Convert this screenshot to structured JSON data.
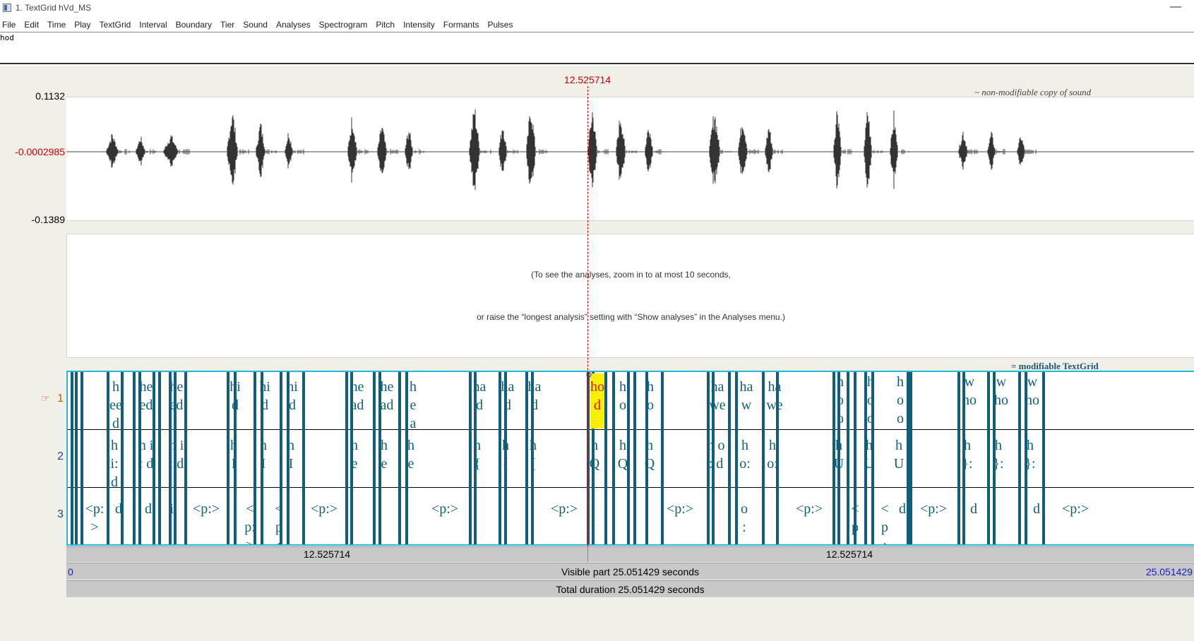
{
  "window": {
    "title": "1. TextGrid hVd_MS"
  },
  "menu": [
    "File",
    "Edit",
    "Time",
    "Play",
    "TextGrid",
    "Interval",
    "Boundary",
    "Tier",
    "Sound",
    "Analyses",
    "Spectrogram",
    "Pitch",
    "Intensity",
    "Formants",
    "Pulses"
  ],
  "text_field": {
    "value": "hod"
  },
  "cursor": {
    "time": "12.525714",
    "time_s": 12.525714
  },
  "sound": {
    "max_label": "0.1132",
    "center_label": "-0.0002985",
    "min_label": "-0.1389",
    "corner_note": "~ non-modifiable copy of sound"
  },
  "analysis": {
    "line1": "(To see the analyses, zoom in to at most 10 seconds,",
    "line2": "or raise the “longest analysis” setting with “Show analyses” in the Analyses menu.)"
  },
  "textgrid": {
    "corner_note": "= modifiable TextGrid",
    "selected_tier_marker": "☞",
    "tier_numbers": [
      "1",
      "2",
      "3"
    ],
    "tier1_labels": [
      {
        "t": 2.05,
        "text": "h\nee\nd"
      },
      {
        "t": 3.1,
        "text": "he\ned"
      },
      {
        "t": 4.05,
        "text": "he\ned"
      },
      {
        "t": 6.45,
        "text": "hi\nd"
      },
      {
        "t": 7.2,
        "text": "hi\nd"
      },
      {
        "t": 8.0,
        "text": "hi\nd"
      },
      {
        "t": 10.45,
        "text": "he\nad"
      },
      {
        "t": 11.2,
        "text": "he\nad"
      },
      {
        "t": 11.9,
        "text": "h\ne\na"
      },
      {
        "t": 14.75,
        "text": "ha\nd"
      },
      {
        "t": 15.45,
        "text": "ha\nd"
      },
      {
        "t": 16.15,
        "text": "ha\nd"
      },
      {
        "t": 18.9,
        "text": "h\no"
      },
      {
        "t": 19.6,
        "text": "h\no"
      },
      {
        "t": 22.5,
        "text": "ha\nwe"
      },
      {
        "t": 23.25,
        "text": "ha\nw"
      },
      {
        "t": 23.95,
        "text": "ha\nwe"
      }
    ],
    "tier1_selected": {
      "text": "ho\nd"
    },
    "tier1_right_labels": [
      "h\no\no",
      "h\no\no",
      "h\no\no",
      "w\nho",
      "w\nho",
      "w\nho"
    ],
    "tier2_labels": [
      "h\ni:\nd",
      "h i\n: d",
      "h i\n: d",
      "h\nI",
      "h\nI",
      "h\nI",
      "h\ne",
      "h\ne",
      "h\ne",
      "h\n{",
      "h\n{",
      "h\n{",
      "h\nQ",
      "h\nQ",
      "h\nQ",
      "h o\n: d",
      "h\no:",
      "h\no:",
      "h\nU",
      "h\nU",
      "h\nU",
      "h\n}:",
      "h\n}:",
      "h\n}:"
    ],
    "tier3_labels": [
      "<p:\n>",
      "d",
      "d",
      "i:",
      "<p:>",
      "<\np:\n>",
      "<\np\n:",
      "<p:>",
      "<p:>",
      "<p:>",
      "<p:>",
      "o\n:",
      "<p:>",
      "<\np\n:",
      "<\np\n:",
      "d",
      "<p:>",
      "d",
      "d",
      "<p:>"
    ]
  },
  "bottom": {
    "left_time": "12.525714",
    "right_time": "12.525714",
    "visible_start": "0",
    "visible_label": "Visible part 25.051429 seconds",
    "visible_end": "25.051429",
    "total_label": "Total duration 25.051429 seconds"
  }
}
